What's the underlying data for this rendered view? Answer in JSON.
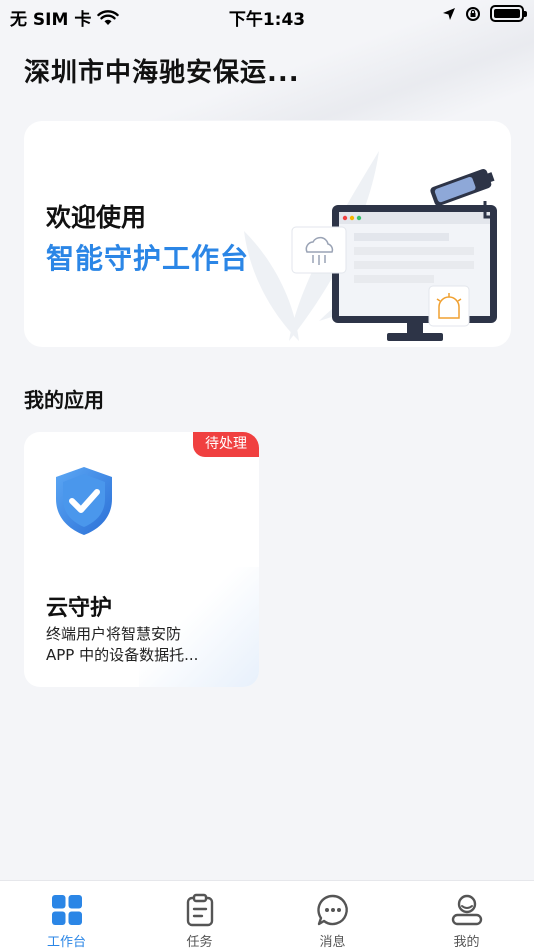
{
  "status_bar": {
    "carrier": "无 SIM 卡",
    "time": "下午1:43"
  },
  "header": {
    "company": "深圳市中海驰安保运..."
  },
  "banner": {
    "line1": "欢迎使用",
    "line2": "智能守护工作台"
  },
  "apps_section": {
    "title": "我的应用",
    "items": [
      {
        "badge": "待处理",
        "name": "云守护",
        "desc_line1": "终端用户将智慧安防",
        "desc_line2": "APP 中的设备数据托..."
      }
    ]
  },
  "tab_bar": {
    "tabs": [
      {
        "label": "工作台",
        "icon": "grid-icon",
        "active": true
      },
      {
        "label": "任务",
        "icon": "clipboard-icon",
        "active": false
      },
      {
        "label": "消息",
        "icon": "chat-bubble-icon",
        "active": false
      },
      {
        "label": "我的",
        "icon": "user-profile-icon",
        "active": false
      }
    ]
  },
  "colors": {
    "accent": "#2b86e6",
    "badge": "#f04040",
    "background": "#f4f5f8"
  }
}
